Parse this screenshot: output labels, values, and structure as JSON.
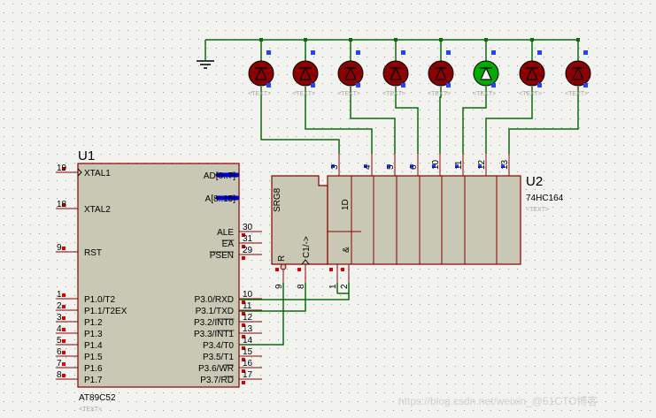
{
  "u1": {
    "ref": "U1",
    "part": "AT89C52",
    "placeholder": "<TEXT>",
    "left_pins": [
      {
        "num": "19",
        "label": "XTAL1"
      },
      {
        "num": "18",
        "label": "XTAL2"
      },
      {
        "num": "9",
        "label": "RST"
      },
      {
        "num": "1",
        "label": "P1.0/T2"
      },
      {
        "num": "2",
        "label": "P1.1/T2EX"
      },
      {
        "num": "3",
        "label": "P1.2"
      },
      {
        "num": "4",
        "label": "P1.3"
      },
      {
        "num": "5",
        "label": "P1.4"
      },
      {
        "num": "6",
        "label": "P1.5"
      },
      {
        "num": "7",
        "label": "P1.6"
      },
      {
        "num": "8",
        "label": "P1.7"
      }
    ],
    "right_bus": [
      {
        "label": "AD[0..7]"
      },
      {
        "label": "A[8..15]"
      }
    ],
    "right_pins": [
      {
        "num": "30",
        "label": "ALE"
      },
      {
        "num": "31",
        "label": "EA"
      },
      {
        "num": "29",
        "label": "PSEN"
      },
      {
        "num": "10",
        "label": "P3.0/RXD"
      },
      {
        "num": "11",
        "label": "P3.1/TXD"
      },
      {
        "num": "12",
        "label": "P3.2/INT0"
      },
      {
        "num": "13",
        "label": "P3.3/INT1"
      },
      {
        "num": "14",
        "label": "P3.4/T0"
      },
      {
        "num": "15",
        "label": "P3.5/T1"
      },
      {
        "num": "16",
        "label": "P3.6/WR"
      },
      {
        "num": "17",
        "label": "P3.7/RD"
      }
    ]
  },
  "u2": {
    "ref": "U2",
    "part": "74HC164",
    "placeholder": "<TEXT>",
    "srg_label": "SRG8",
    "r_label": "R",
    "clk_label": "C1/->",
    "d_label": "1D",
    "amp_label": "&",
    "bottom_pins": [
      "9",
      "8",
      "1",
      "2"
    ],
    "top_pins": [
      "3",
      "4",
      "5",
      "6",
      "10",
      "11",
      "12",
      "13"
    ]
  },
  "leds": [
    {
      "label": "<TEXT>",
      "state": "off"
    },
    {
      "label": "<TEXT>",
      "state": "off"
    },
    {
      "label": "<TEXT>",
      "state": "off"
    },
    {
      "label": "<TEXT>",
      "state": "off"
    },
    {
      "label": "<TEXT>",
      "state": "off"
    },
    {
      "label": "<TEXT>",
      "state": "on"
    },
    {
      "label": "<TEXT>",
      "state": "off"
    },
    {
      "label": "<TEXT>",
      "state": "off"
    }
  ],
  "colors": {
    "wire": "#0d6b0d",
    "chip_fill": "#c8c8b4",
    "chip_border": "#8b0000",
    "pin_marker": "#dd0000",
    "probe_marker": "#2244ff",
    "bus": "#0000cc",
    "led_off": "#8b0000",
    "led_on": "#00aa00"
  },
  "watermark": "https://blog.csdn.net/weixin_@51CTO博客"
}
